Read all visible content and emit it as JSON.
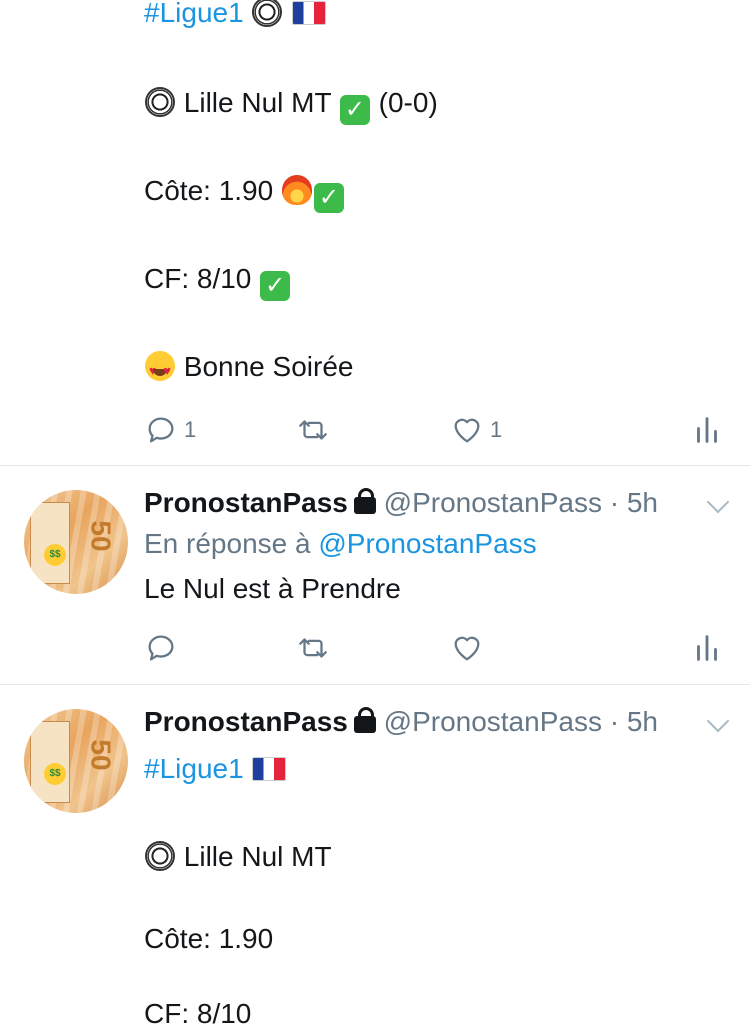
{
  "tweet1": {
    "hashtag": "#Ligue1",
    "line_match": "Lille Nul MT",
    "line_match_score": "(0-0)",
    "line_cote": "Côte: 1.90",
    "line_cf": "CF: 8/10",
    "line_soiree": "Bonne Soirée",
    "reply_count": "1",
    "like_count": "1"
  },
  "tweet2": {
    "name": "PronostanPass",
    "handle": "@PronostanPass",
    "sep": "·",
    "time": "5h",
    "reply_prefix": "En réponse à",
    "reply_to": "@PronostanPass",
    "text": "Le Nul est à Prendre"
  },
  "tweet3": {
    "name": "PronostanPass",
    "handle": "@PronostanPass",
    "sep": "·",
    "time": "5h",
    "hashtag": "#Ligue1",
    "line_match": "Lille Nul MT",
    "line_cote": "Côte: 1.90",
    "line_cf_partial": "CF: 8/10"
  },
  "icons": {
    "reply": "reply-icon",
    "retweet": "retweet-icon",
    "like": "heart-icon",
    "analytics": "analytics-icon",
    "lock": "lock-icon",
    "chevron": "chevron-down-icon"
  },
  "colors": {
    "link": "#1b95e0",
    "secondary": "#657786",
    "icon": "#657786",
    "divider": "#e1e8ed"
  }
}
